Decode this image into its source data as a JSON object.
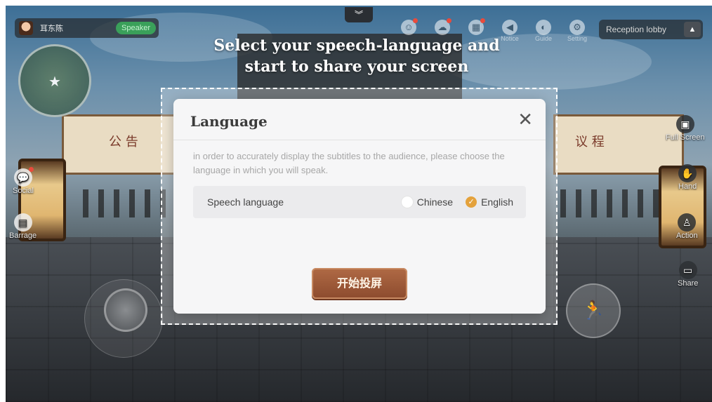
{
  "hud": {
    "user_name": "耳东陈",
    "role_badge": "Speaker",
    "collapse_icon": "chevron-down-icon",
    "location_label": "Reception lobby",
    "top_icons": [
      {
        "name": "members-icon",
        "label": "",
        "glyph": "👥"
      },
      {
        "name": "meeting-icon",
        "label": "",
        "glyph": "☁"
      },
      {
        "name": "calendar-icon",
        "label": "",
        "glyph": "▦"
      },
      {
        "name": "notice-icon",
        "label": "Notice",
        "glyph": "🔈"
      },
      {
        "name": "guide-icon",
        "label": "Guide",
        "glyph": "◐"
      },
      {
        "name": "setting-icon",
        "label": "Setting",
        "glyph": "⚙"
      }
    ]
  },
  "headline": {
    "line1": "Select your speech-language and",
    "line2": "start to share your screen"
  },
  "left_controls": {
    "social_label": "Social",
    "barrage_label": "Barrage"
  },
  "right_controls": {
    "fullscreen_label": "Full Screen",
    "hand_label": "Hand",
    "action_label": "Action",
    "share_label": "Share"
  },
  "scene": {
    "left_banner_text": "公 告",
    "right_banner_text": "议 程"
  },
  "dialog": {
    "title": "Language",
    "description": "in order to accurately display the subtitles to the audience,  please choose the language in which you will speak.",
    "speech_language_label": "Speech language",
    "options": [
      {
        "label": "Chinese",
        "selected": false
      },
      {
        "label": "English",
        "selected": true
      }
    ],
    "start_button_label": "开始投屏"
  },
  "colors": {
    "accent": "#e4a23c",
    "start_button": "#9c5636",
    "speaker_badge": "#3aa05a"
  }
}
